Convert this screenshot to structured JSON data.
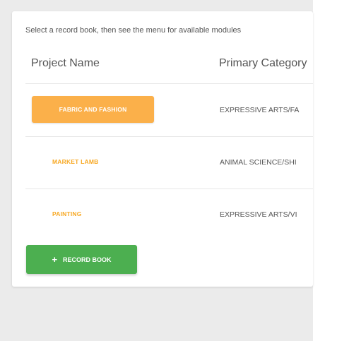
{
  "instructions": "Select a record book, then see the menu for available modules",
  "columns": {
    "project_name": "Project Name",
    "primary_category": "Primary Category"
  },
  "rows": [
    {
      "project": "FABRIC AND FASHION",
      "category": "EXPRESSIVE ARTS/FA",
      "selected": true
    },
    {
      "project": "MARKET LAMB",
      "category": "ANIMAL SCIENCE/SHI",
      "selected": false
    },
    {
      "project": "PAINTING",
      "category": "EXPRESSIVE ARTS/VI",
      "selected": false
    }
  ],
  "add_button": {
    "icon": "plus-icon",
    "label": "RECORD BOOK"
  },
  "colors": {
    "accent_orange": "#fbb04a",
    "link_orange": "#f7a823",
    "add_green": "#4caf50"
  }
}
